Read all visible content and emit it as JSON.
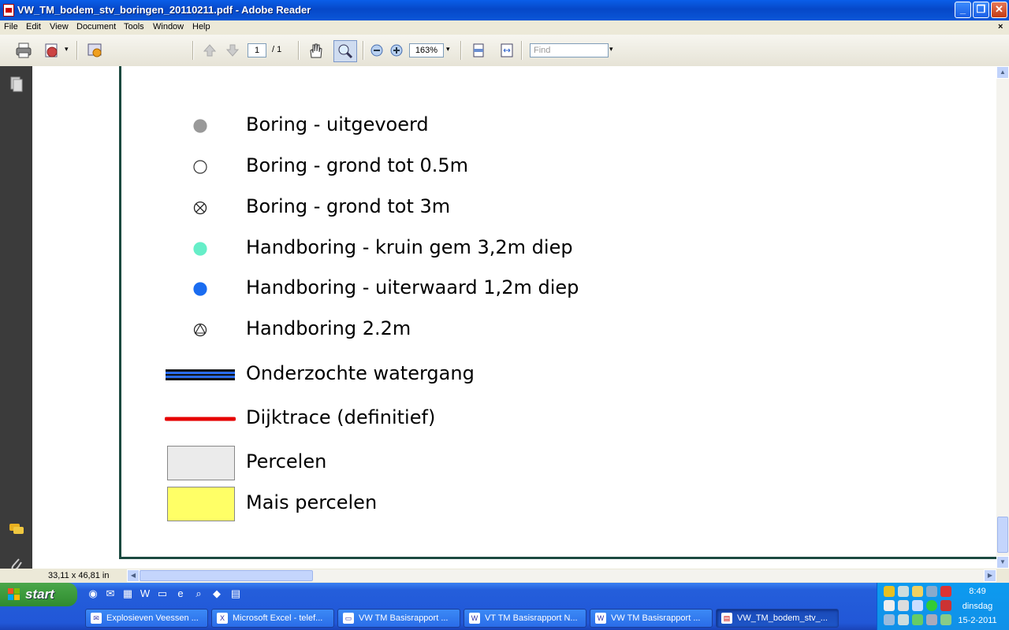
{
  "window": {
    "title": "VW_TM_bodem_stv_boringen_20110211.pdf - Adobe Reader"
  },
  "menu": [
    "File",
    "Edit",
    "View",
    "Document",
    "Tools",
    "Window",
    "Help"
  ],
  "toolbar": {
    "page_current": "1",
    "page_total": "/ 1",
    "zoom": "163%",
    "find_placeholder": "Find"
  },
  "legend": {
    "items": [
      {
        "label": "Boring - uitgevoerd",
        "symbol": "filled-circle",
        "color": "#999999"
      },
      {
        "label": "Boring - grond tot 0.5m",
        "symbol": "open-circle",
        "color": "#ffffff"
      },
      {
        "label": "Boring - grond tot 3m",
        "symbol": "crossed-circle",
        "color": "#ffffff"
      },
      {
        "label": "Handboring - kruin gem 3,2m diep",
        "symbol": "filled-circle",
        "color": "#66eec8"
      },
      {
        "label": "Handboring - uiterwaard 1,2m diep",
        "symbol": "filled-circle",
        "color": "#1a6cf0"
      },
      {
        "label": "Handboring 2.2m",
        "symbol": "triangle-circle",
        "color": "#ffffff"
      },
      {
        "label": "Onderzochte watergang",
        "symbol": "blue-double-line",
        "color": "#2a6cf0"
      },
      {
        "label": "Dijktrace (definitief)",
        "symbol": "red-line",
        "color": "#e60000"
      },
      {
        "label": "Percelen",
        "symbol": "box",
        "color": "#ebebeb"
      },
      {
        "label": "Mais percelen",
        "symbol": "box",
        "color": "#ffff66"
      }
    ]
  },
  "status": {
    "page_size": "33,11 x 46,81 in"
  },
  "taskbar": {
    "start_label": "start",
    "tasks": [
      {
        "label": "Explosieven Veessen ...",
        "active": false
      },
      {
        "label": "Microsoft Excel - telef...",
        "active": false
      },
      {
        "label": "VW TM Basisrapport ...",
        "active": false
      },
      {
        "label": "VT TM Basisrapport N...",
        "active": false
      },
      {
        "label": "VW TM Basisrapport ...",
        "active": false
      },
      {
        "label": "VW_TM_bodem_stv_...",
        "active": true
      }
    ],
    "clock": {
      "time": "8:49",
      "day": "dinsdag",
      "date": "15-2-2011"
    }
  }
}
